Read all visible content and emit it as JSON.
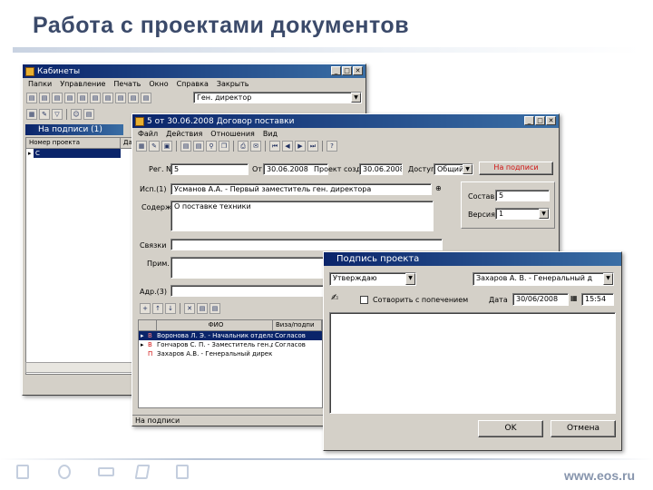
{
  "slide": {
    "title": "Работа с проектами документов",
    "site": "www.eos.ru"
  },
  "win1": {
    "title": "Кабинеты",
    "menu": [
      "Папки",
      "Управление",
      "Печать",
      "Окно",
      "Справка",
      "Закрыть"
    ],
    "role_value": "Ген. директор",
    "folder_tab": "На подписи (1)",
    "col_header": "Номер проекта",
    "col_header2": "Дат",
    "row_value": "С"
  },
  "win2": {
    "title": "5 от 30.06.2008 Договор поставки",
    "menu": [
      "Файл",
      "Действия",
      "Отношения",
      "Вид"
    ],
    "reg_label": "Рег. N:",
    "reg_value": "5",
    "from_label": "От",
    "date_value": "30.06.2008",
    "proj_label": "Проект создан",
    "proj_value": "30.06.2008",
    "access_label": "Доступ",
    "access_value": "Общий",
    "sign_button": "На подписи",
    "author_label": "Исп.(1)",
    "author_value": "Усманов А.А. - Первый заместитель ген. директора",
    "content_label": "Содерж.",
    "content_value": "О поставке техники",
    "sostav_label": "Состав:",
    "sostav_value": "5",
    "version_label": "Версия:",
    "version_value": "1",
    "links_label": "Связки",
    "prim_label": "Прим.",
    "adr_label": "Адр.(3)",
    "grid_col1": "ФИО",
    "grid_col2": "Виза/подпи",
    "grid_rows": [
      {
        "mark": "В",
        "name": "Воронова Л. Э. - Начальник отдела",
        "status": "Согласов"
      },
      {
        "mark": "В",
        "name": "Гончаров С. П. - Заместитель ген.д",
        "status": "Согласов"
      },
      {
        "mark": "П",
        "name": "Захаров А.В. - Генеральный дирек",
        "status": ""
      }
    ],
    "status_bar": "На подписи"
  },
  "win3": {
    "title": "Подпись проекта",
    "action_value": "Утверждаю",
    "signer_value": "Захаров А. В. - Генеральный д",
    "checkbox_label": "Сотворить с попечением",
    "date_label": "Дата",
    "date_value": "30/06/2008",
    "time_value": "15:54",
    "ok_button": "OK",
    "cancel_button": "Отмена"
  }
}
